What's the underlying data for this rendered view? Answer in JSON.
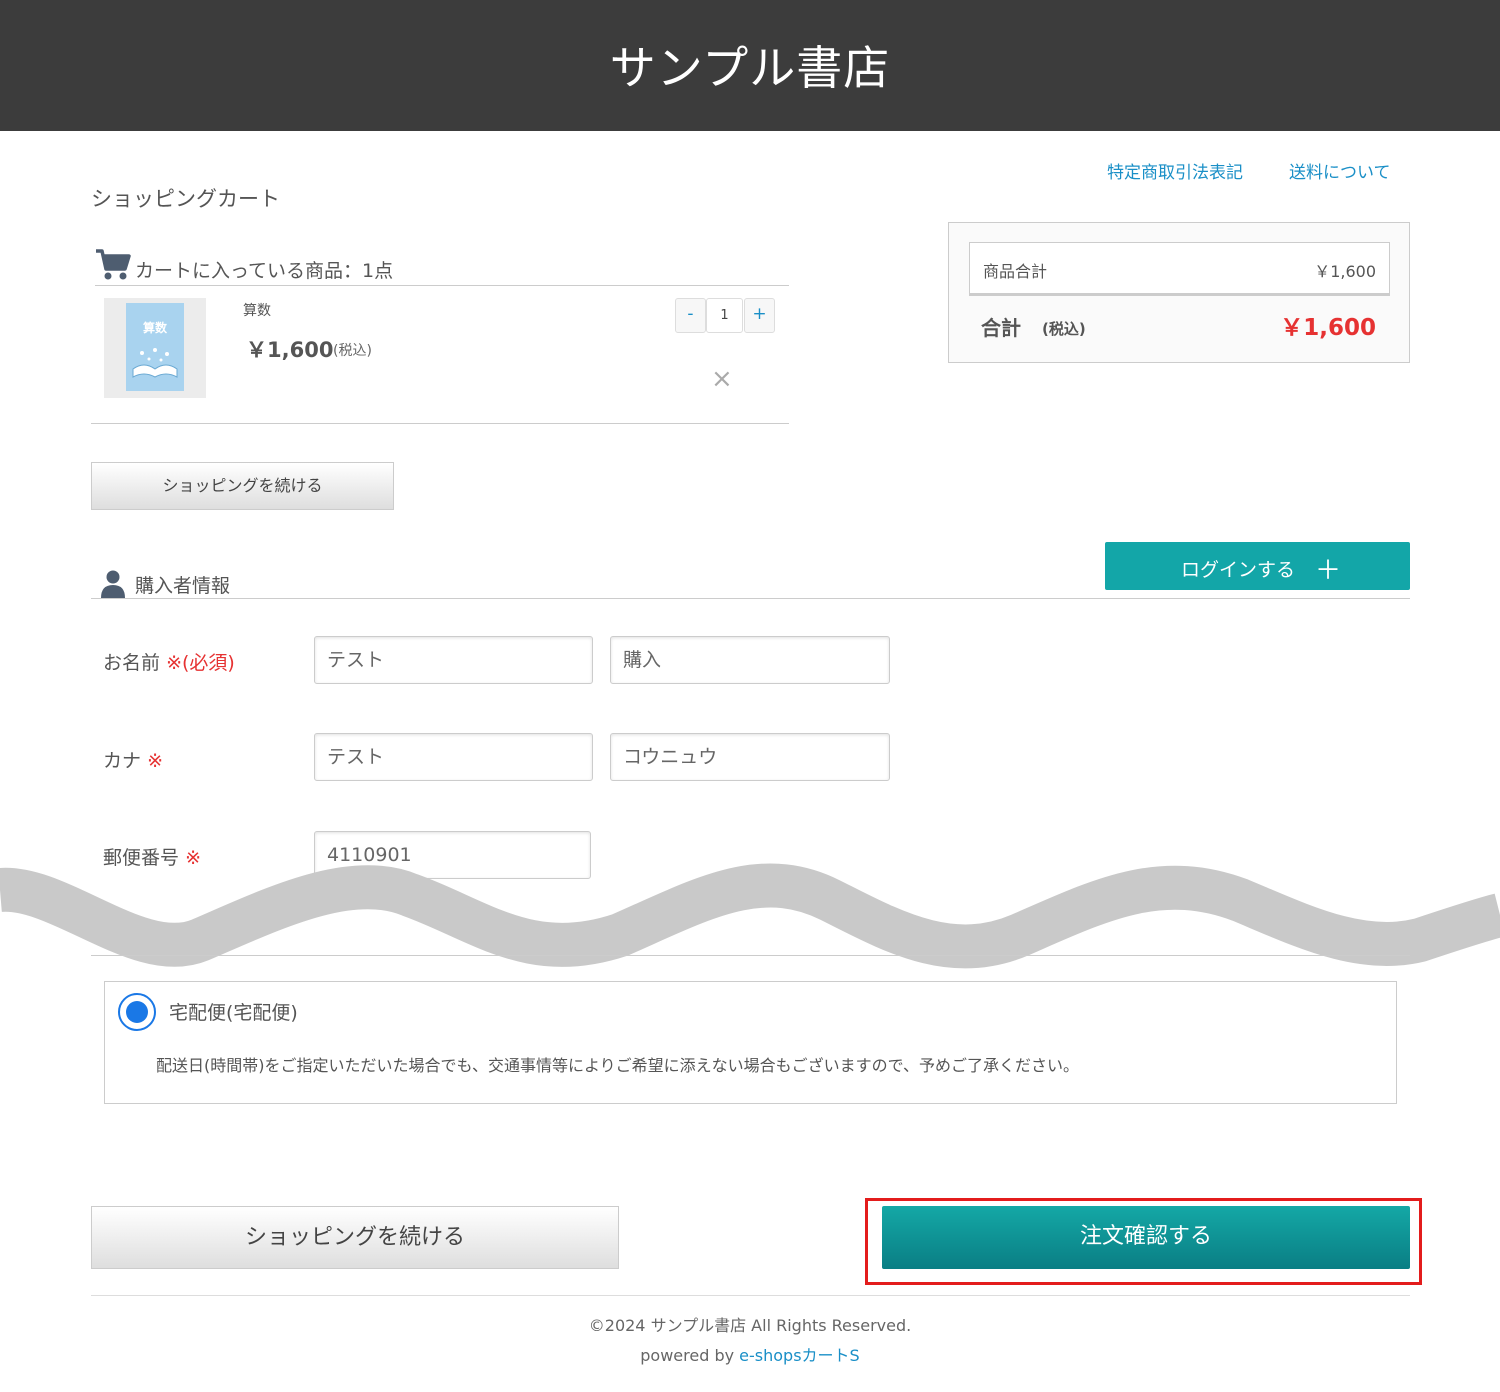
{
  "header": {
    "title": "サンプル書店"
  },
  "top_links": {
    "law": "特定商取引法表記",
    "shipping": "送料について"
  },
  "page_title": "ショッピングカート",
  "cart": {
    "heading": "カートに入っている商品：1点",
    "icon": "cart-icon",
    "item": {
      "thumb_text": "算数",
      "name": "算数",
      "price": "￥1,600",
      "tax_note": "(税込)",
      "qty_minus": "-",
      "qty": "1",
      "qty_plus": "+",
      "remove": "×"
    },
    "continue_label": "ショッピングを続ける"
  },
  "summary": {
    "subtotal_label": "商品合計",
    "subtotal_value": "￥1,600",
    "total_label": "合計",
    "total_tax": "(税込)",
    "total_value": "￥1,600",
    "total_color": "#e63232"
  },
  "login": {
    "label": "ログインする",
    "plus": "＋",
    "color": "#13a6a8"
  },
  "buyer": {
    "heading": "購入者情報",
    "icon": "person-icon",
    "name_label": "お名前",
    "name_req": "※(必須)",
    "last_name": "テスト",
    "first_name": "購入",
    "kana_label": "カナ",
    "kana_req": "※",
    "kana_last": "テスト",
    "kana_first": "コウニュウ",
    "zip_label": "郵便番号",
    "zip_req": "※",
    "zip": "4110901"
  },
  "shipping": {
    "method": "宅配便(宅配便)",
    "note": "配送日(時間帯)をご指定いただいた場合でも、交通事情等によりご希望に添えない場合もございますので、予めご了承ください。",
    "radio_color": "#1a78e6"
  },
  "actions": {
    "continue_label": "ショッピングを続ける",
    "confirm_label": "注文確認する",
    "highlight_color": "#e31c1c"
  },
  "footer": {
    "copyright": "©2024 サンプル書店 All Rights Reserved.",
    "powered_prefix": "powered by ",
    "powered_link": "e-shopsカートS"
  }
}
